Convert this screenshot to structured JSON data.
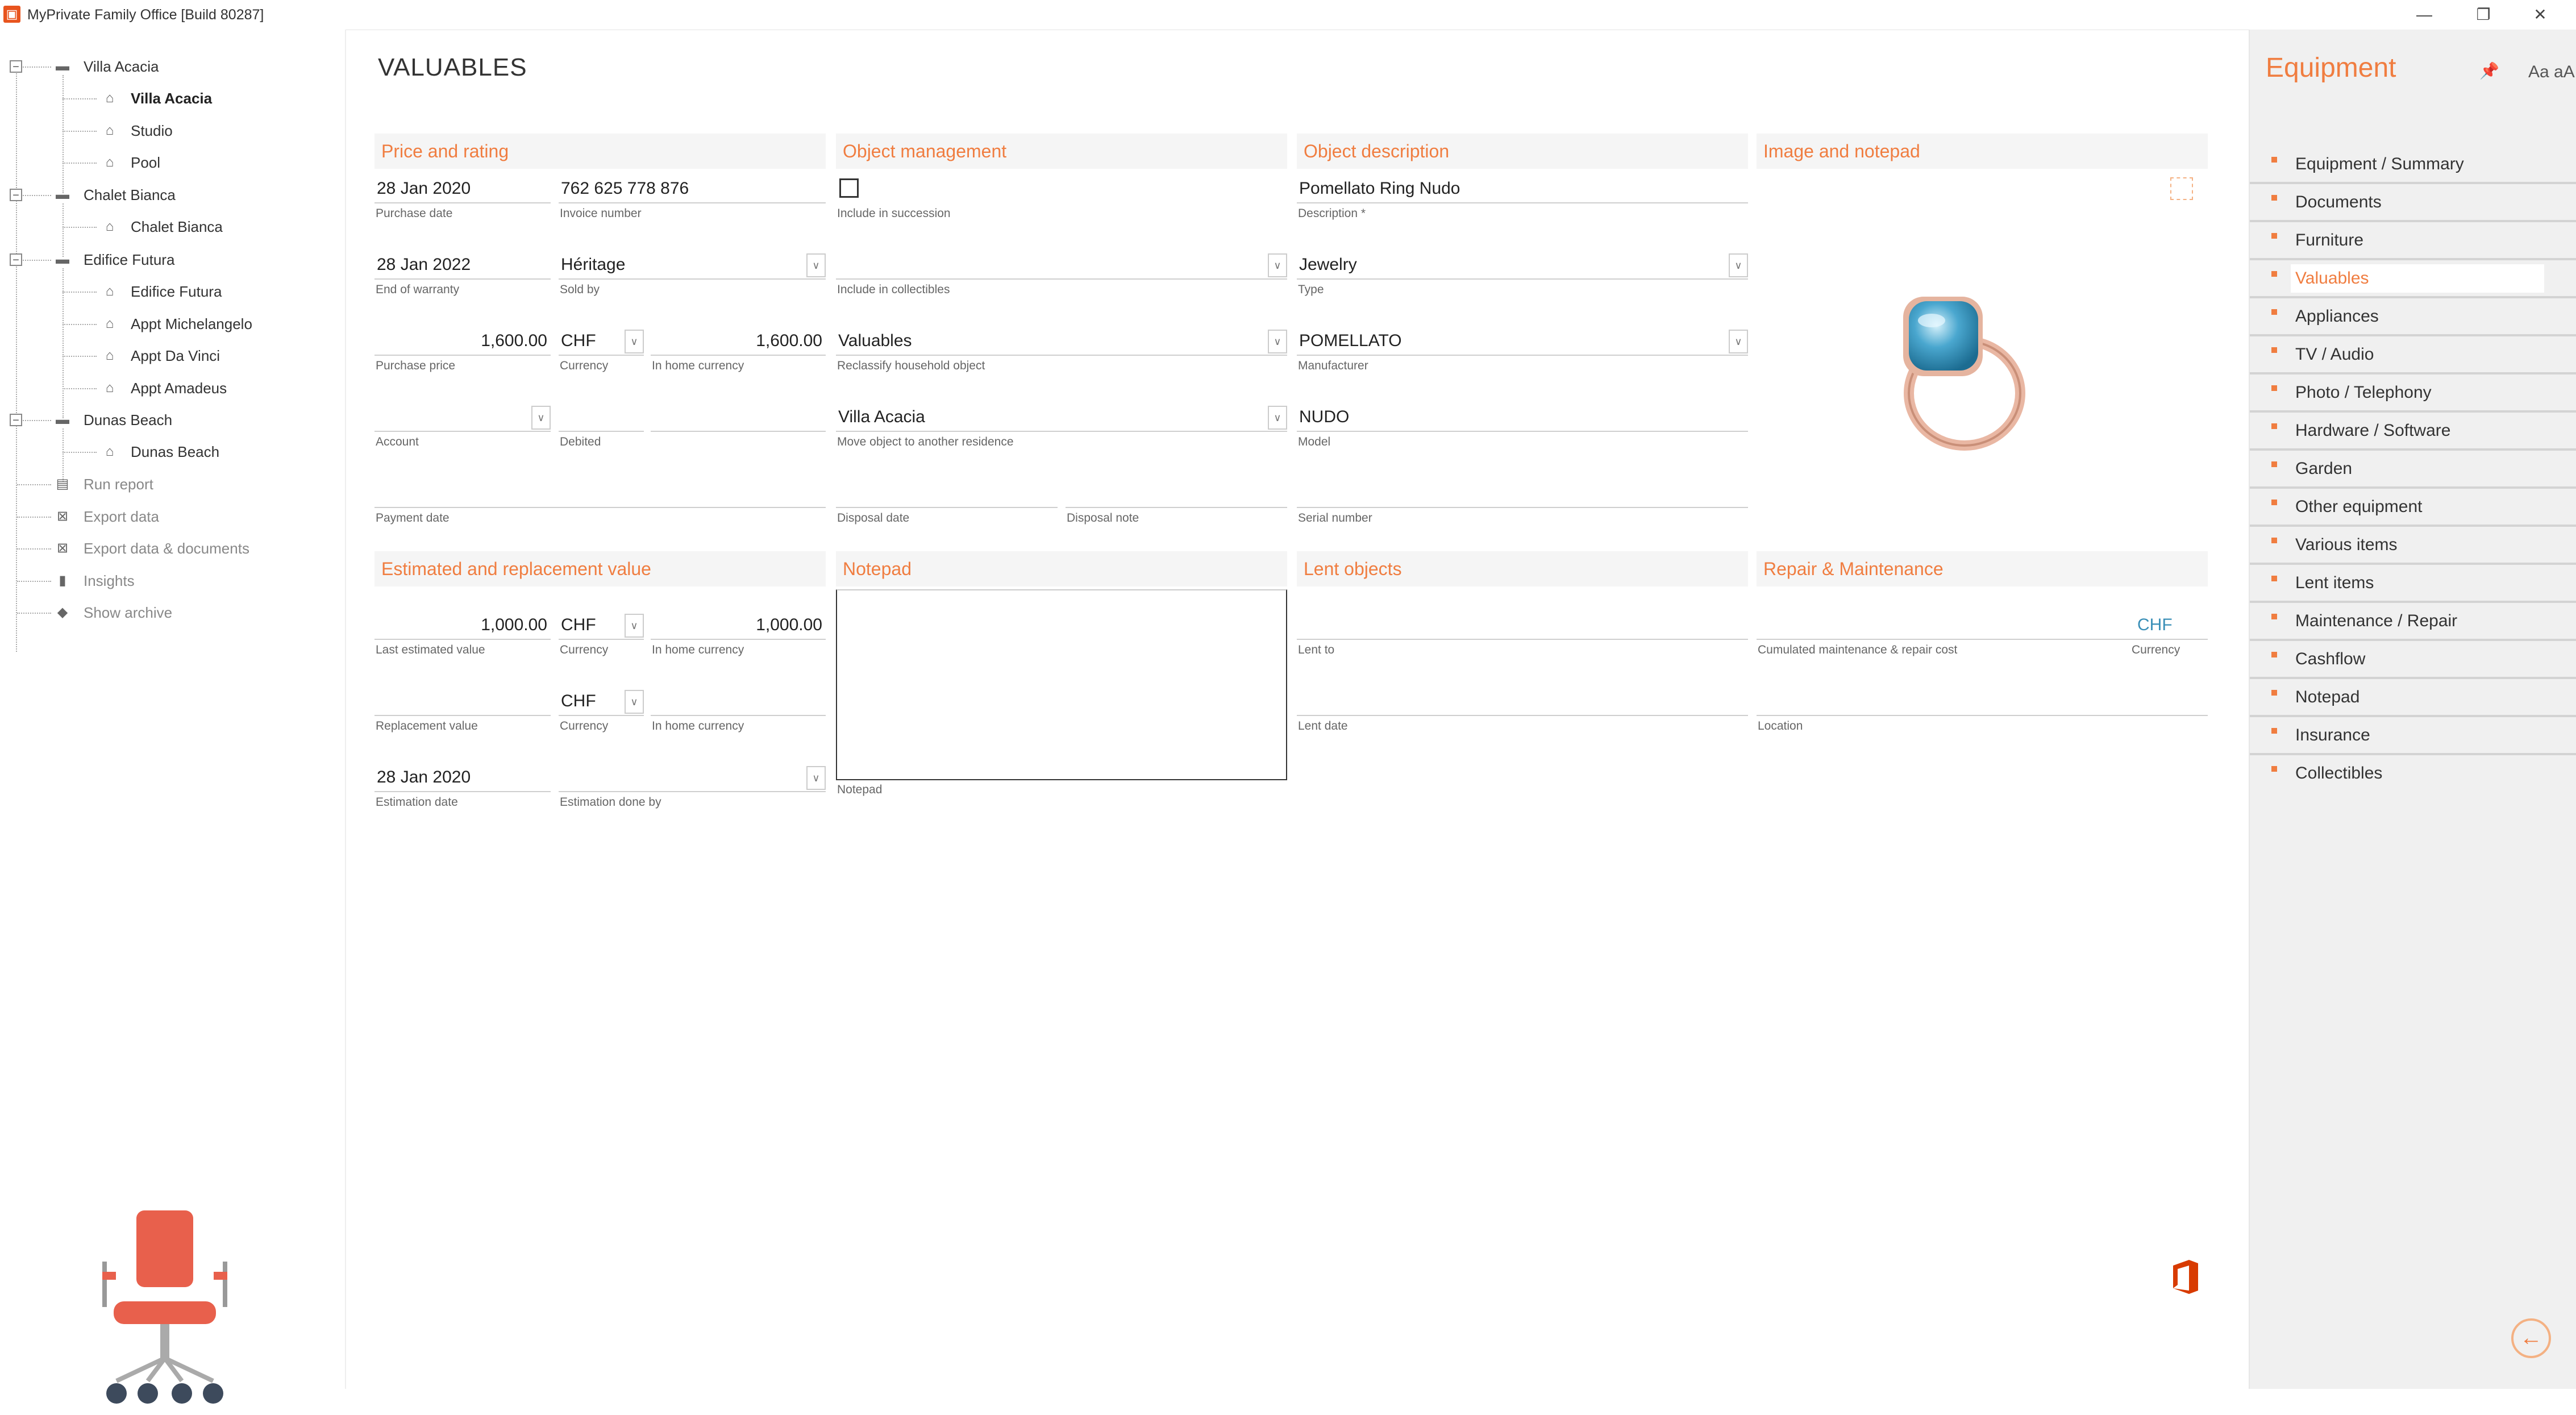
{
  "window": {
    "title": "MyPrivate Family Office [Build 80287]",
    "min_glyph": "—",
    "restore_glyph": "❐",
    "close_glyph": "✕"
  },
  "tree": {
    "groups": [
      {
        "label": "Villa Acacia",
        "toggle": "−",
        "children": [
          "Villa Acacia",
          "Studio",
          "Pool"
        ]
      },
      {
        "label": "Chalet Bianca",
        "toggle": "−",
        "children": [
          "Chalet Bianca"
        ]
      },
      {
        "label": "Edifice Futura",
        "toggle": "−",
        "children": [
          "Edifice Futura",
          "Appt Michelangelo",
          "Appt Da Vinci",
          "Appt Amadeus"
        ]
      },
      {
        "label": "Dunas Beach",
        "toggle": "−",
        "children": [
          "Dunas Beach"
        ]
      }
    ],
    "selected": "Villa Acacia",
    "actions": [
      "Run report",
      "Export data",
      "Export data & documents",
      "Insights",
      "Show archive"
    ]
  },
  "page": {
    "heading": "VALUABLES"
  },
  "sections": {
    "price": "Price and rating",
    "object_mgmt": "Object management",
    "object_desc": "Object description",
    "image": "Image and notepad",
    "estimated": "Estimated and replacement value",
    "notepad": "Notepad",
    "lent": "Lent objects",
    "repair": "Repair & Maintenance"
  },
  "fields": {
    "purchase_date": {
      "value": "28 Jan 2020",
      "caption": "Purchase date"
    },
    "invoice_number": {
      "value": "762 625 778 876",
      "caption": "Invoice number"
    },
    "end_warranty": {
      "value": "28 Jan 2022",
      "caption": "End of warranty"
    },
    "sold_by": {
      "value": "Héritage",
      "caption": "Sold by"
    },
    "purchase_price": {
      "value": "1,600.00",
      "caption": "Purchase price"
    },
    "currency1": {
      "value": "CHF",
      "caption": "Currency"
    },
    "home_currency1": {
      "value": "1,600.00",
      "caption": "In home currency"
    },
    "account": {
      "value": "",
      "caption": "Account"
    },
    "debited": {
      "value": "",
      "caption": "Debited"
    },
    "payment_date": {
      "value": "",
      "caption": "Payment date"
    },
    "include_succession": {
      "caption": "Include in succession"
    },
    "include_collectibles": {
      "value": "",
      "caption": "Include in collectibles"
    },
    "reclassify": {
      "value": "Valuables",
      "caption": "Reclassify household object"
    },
    "move_residence": {
      "value": "Villa Acacia",
      "caption": "Move object to another residence"
    },
    "disposal_date": {
      "value": "",
      "caption": "Disposal date"
    },
    "disposal_note": {
      "value": "",
      "caption": "Disposal note"
    },
    "description": {
      "value": "Pomellato Ring Nudo",
      "caption": "Description *"
    },
    "type": {
      "value": "Jewelry",
      "caption": "Type"
    },
    "manufacturer": {
      "value": "POMELLATO",
      "caption": "Manufacturer"
    },
    "model": {
      "value": "NUDO",
      "caption": "Model"
    },
    "serial": {
      "value": "",
      "caption": "Serial number"
    },
    "last_est": {
      "value": "1,000.00",
      "caption": "Last estimated value"
    },
    "currency2": {
      "value": "CHF",
      "caption": "Currency"
    },
    "home_currency2": {
      "value": "1,000.00",
      "caption": "In home currency"
    },
    "replacement": {
      "value": "",
      "caption": "Replacement value"
    },
    "currency3": {
      "value": "CHF",
      "caption": "Currency"
    },
    "home_currency3": {
      "value": "",
      "caption": "In home currency"
    },
    "est_date": {
      "value": "28 Jan 2020",
      "caption": "Estimation date"
    },
    "est_by": {
      "value": "",
      "caption": "Estimation done by"
    },
    "notepad": {
      "caption": "Notepad"
    },
    "lent_to": {
      "value": "",
      "caption": "Lent to"
    },
    "lent_date": {
      "value": "",
      "caption": "Lent date"
    },
    "cum_maint": {
      "value": "",
      "caption": "Cumulated maintenance & repair cost"
    },
    "maint_currency": {
      "value": "CHF",
      "caption": "Currency"
    },
    "location": {
      "value": "",
      "caption": "Location"
    }
  },
  "right_panel": {
    "title": "Equipment",
    "pin_glyph": "📌",
    "font_toggle": "Aa aA",
    "items": [
      "Equipment / Summary",
      "Documents",
      "Furniture",
      "Valuables",
      "Appliances",
      "TV / Audio",
      "Photo / Telephony",
      "Hardware / Software",
      "Garden",
      "Other equipment",
      "Various items",
      "Lent items",
      "Maintenance / Repair",
      "Cashflow",
      "Notepad",
      "Insurance",
      "Collectibles"
    ],
    "active": "Valuables",
    "back_glyph": "←"
  },
  "colors": {
    "accent": "#f07d40",
    "chair": "#e8604c",
    "office": "#d83b01",
    "link_blue": "#3a8fb7"
  },
  "icons": {
    "folder": "folder-icon",
    "home": "home-icon",
    "report": "report-icon",
    "export": "export-icon",
    "insights": "bar-chart-icon",
    "archive": "archive-icon",
    "ring": "ring-image",
    "office": "office-logo-icon",
    "chair": "office-chair-illustration"
  }
}
